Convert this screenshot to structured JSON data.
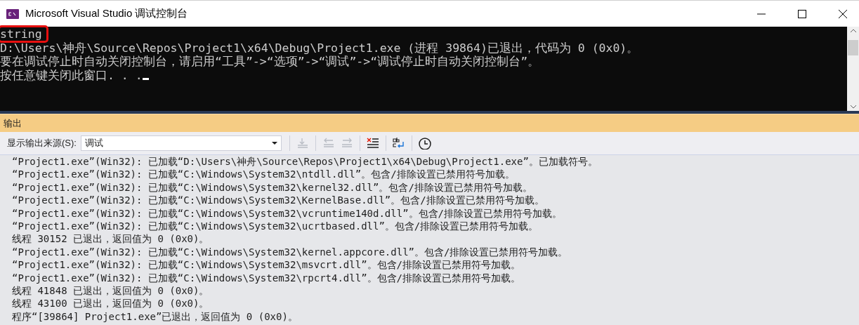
{
  "window": {
    "title": "Microsoft Visual Studio 调试控制台"
  },
  "console": {
    "lines": [
      {
        "text": "string",
        "highlighted": true
      },
      {
        "text": "D:\\Users\\神舟\\Source\\Repos\\Project1\\x64\\Debug\\Project1.exe (进程 39864)已退出，代码为 0 (0x0)。",
        "highlighted": false
      },
      {
        "text": "要在调试停止时自动关闭控制台，请启用“工具”->“选项”->“调试”->“调试停止时自动关闭控制台”。",
        "highlighted": false
      },
      {
        "text": "按任意键关闭此窗口. . .",
        "highlighted": false
      }
    ]
  },
  "output_panel": {
    "title": "输出",
    "source_label": "显示输出来源(S):",
    "source_value": "调试",
    "toolbar": [
      {
        "kind": "goto",
        "disabled": true
      },
      {
        "kind": "prev",
        "disabled": true
      },
      {
        "kind": "next",
        "disabled": true
      },
      {
        "kind": "clear",
        "disabled": false
      },
      {
        "kind": "wrap",
        "disabled": false
      },
      {
        "kind": "clock",
        "disabled": false
      }
    ],
    "lines": [
      "“Project1.exe”(Win32): 已加载“D:\\Users\\神舟\\Source\\Repos\\Project1\\x64\\Debug\\Project1.exe”。已加载符号。",
      "“Project1.exe”(Win32): 已加载“C:\\Windows\\System32\\ntdll.dll”。包含/排除设置已禁用符号加载。",
      "“Project1.exe”(Win32): 已加载“C:\\Windows\\System32\\kernel32.dll”。包含/排除设置已禁用符号加载。",
      "“Project1.exe”(Win32): 已加载“C:\\Windows\\System32\\KernelBase.dll”。包含/排除设置已禁用符号加载。",
      "“Project1.exe”(Win32): 已加载“C:\\Windows\\System32\\vcruntime140d.dll”。包含/排除设置已禁用符号加载。",
      "“Project1.exe”(Win32): 已加载“C:\\Windows\\System32\\ucrtbased.dll”。包含/排除设置已禁用符号加载。",
      "线程 30152 已退出，返回值为 0 (0x0)。",
      "“Project1.exe”(Win32): 已加载“C:\\Windows\\System32\\kernel.appcore.dll”。包含/排除设置已禁用符号加载。",
      "“Project1.exe”(Win32): 已加载“C:\\Windows\\System32\\msvcrt.dll”。包含/排除设置已禁用符号加载。",
      "“Project1.exe”(Win32): 已加载“C:\\Windows\\System32\\rpcrt4.dll”。包含/排除设置已禁用符号加载。",
      "线程 41848 已退出，返回值为 0 (0x0)。",
      "线程 43100 已退出，返回值为 0 (0x0)。",
      "程序“[39864] Project1.exe”已退出，返回值为 0 (0x0)。"
    ]
  }
}
